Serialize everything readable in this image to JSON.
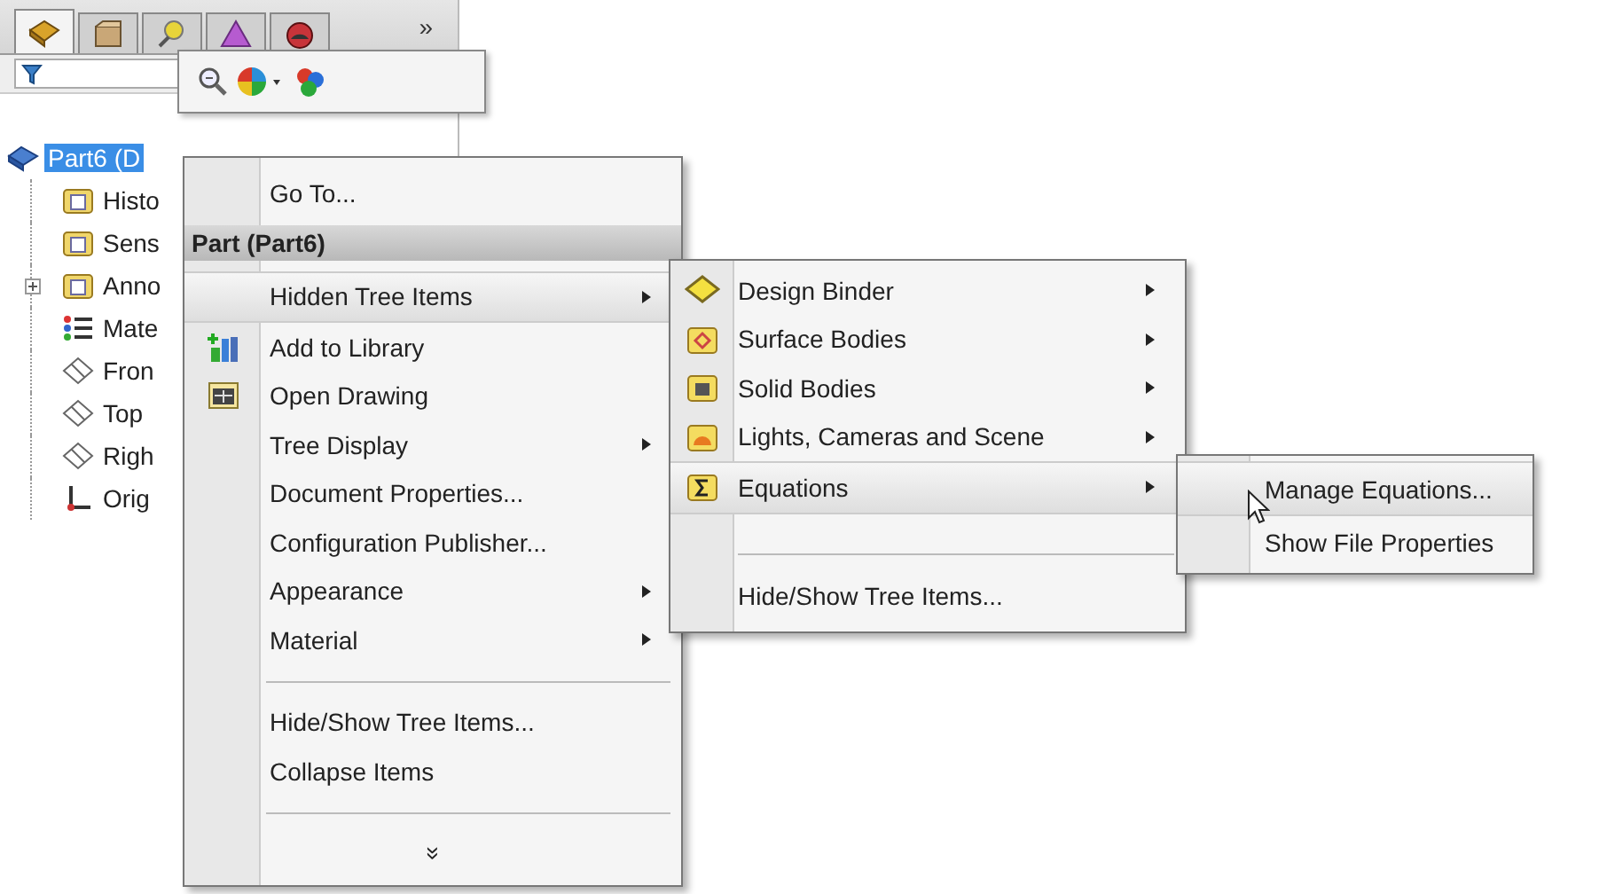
{
  "panel": {
    "tabs": [
      {
        "selected": true
      },
      {
        "selected": false
      },
      {
        "selected": false
      },
      {
        "selected": false
      },
      {
        "selected": false
      }
    ],
    "more": "»"
  },
  "tree": {
    "root": {
      "label": "Part6 (D",
      "selected": true
    },
    "items": [
      {
        "label": "Histo",
        "collapsed": false
      },
      {
        "label": "Sens",
        "collapsed": false
      },
      {
        "label": "Anno",
        "collapsed": true
      },
      {
        "label": "Mate",
        "collapsed": false
      },
      {
        "label": "Fron",
        "collapsed": false
      },
      {
        "label": "Top",
        "collapsed": false
      },
      {
        "label": "Righ",
        "collapsed": false
      },
      {
        "label": "Orig",
        "collapsed": false
      }
    ]
  },
  "context_menu": {
    "items": [
      {
        "kind": "item",
        "label": "Go To...",
        "submenu": false,
        "selected": false
      },
      {
        "kind": "header",
        "label": "Part (Part6)"
      },
      {
        "kind": "item",
        "label": "Hidden Tree Items",
        "submenu": true,
        "selected": true
      },
      {
        "kind": "item",
        "label": "Add to Library",
        "submenu": false,
        "selected": false
      },
      {
        "kind": "item",
        "label": "Open Drawing",
        "submenu": false,
        "selected": false
      },
      {
        "kind": "item",
        "label": "Tree Display",
        "submenu": true,
        "selected": false
      },
      {
        "kind": "item",
        "label": "Document Properties...",
        "submenu": false,
        "selected": false
      },
      {
        "kind": "item",
        "label": "Configuration Publisher...",
        "submenu": false,
        "selected": false
      },
      {
        "kind": "item",
        "label": "Appearance",
        "submenu": true,
        "selected": false
      },
      {
        "kind": "item",
        "label": "Material",
        "submenu": true,
        "selected": false
      },
      {
        "kind": "separator"
      },
      {
        "kind": "item",
        "label": "Hide/Show Tree Items...",
        "submenu": false,
        "selected": false
      },
      {
        "kind": "item",
        "label": "Collapse Items",
        "submenu": false,
        "selected": false
      },
      {
        "kind": "separator"
      },
      {
        "kind": "more",
        "label": "»"
      }
    ]
  },
  "hidden_items_menu": {
    "items": [
      {
        "kind": "item",
        "label": "Design Binder",
        "submenu": true,
        "selected": false
      },
      {
        "kind": "item",
        "label": "Surface Bodies",
        "submenu": true,
        "selected": false
      },
      {
        "kind": "item",
        "label": "Solid Bodies",
        "submenu": true,
        "selected": false
      },
      {
        "kind": "item",
        "label": "Lights, Cameras and Scene",
        "submenu": true,
        "selected": false
      },
      {
        "kind": "item",
        "label": "Equations",
        "submenu": true,
        "selected": true
      },
      {
        "kind": "separator"
      },
      {
        "kind": "item",
        "label": "Hide/Show Tree Items...",
        "submenu": false,
        "selected": false
      }
    ]
  },
  "equations_menu": {
    "items": [
      {
        "kind": "item",
        "label": "Manage Equations...",
        "submenu": false,
        "selected": true
      },
      {
        "kind": "item",
        "label": "Show File Properties",
        "submenu": false,
        "selected": false
      }
    ]
  }
}
